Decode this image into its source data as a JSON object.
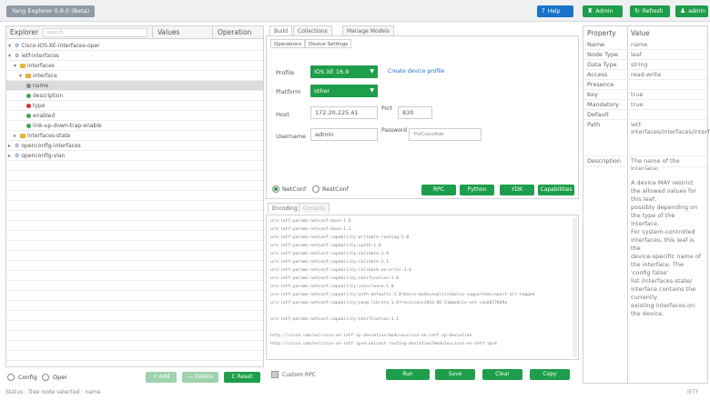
{
  "app": {
    "title": "Yang Explorer 0.8.0 (Beta)"
  },
  "top_buttons": {
    "help": "Help",
    "admin": "Admin",
    "refresh": "Refresh",
    "user": "admin"
  },
  "explorer": {
    "col_explorer": "Explorer",
    "search_placeholder": "search",
    "col_values": "Values",
    "col_operation": "Operation",
    "tree": [
      {
        "label": "Cisco-IOS-XE-interfaces-oper",
        "icon": "node"
      },
      {
        "label": "ietf-interfaces",
        "icon": "node"
      },
      {
        "label": "interfaces",
        "icon": "folder"
      },
      {
        "label": "interface",
        "icon": "folder"
      },
      {
        "label": "name",
        "icon": "key"
      },
      {
        "label": "description",
        "icon": "leaf"
      },
      {
        "label": "type",
        "icon": "leaf-red"
      },
      {
        "label": "enabled",
        "icon": "leaf"
      },
      {
        "label": "link-up-down-trap-enable",
        "icon": "leaf"
      },
      {
        "label": "interfaces-state",
        "icon": "folder"
      },
      {
        "label": "openconfig-interfaces",
        "icon": "node"
      },
      {
        "label": "openconfig-vlan",
        "icon": "node"
      }
    ],
    "footer": {
      "config": "Config",
      "oper": "Oper",
      "add": "+ Add",
      "delete": "— Delete",
      "reset": "C Reset"
    }
  },
  "center": {
    "tabs": [
      "Build",
      "Collections",
      "Manage Models"
    ],
    "subtabs": [
      "Operations",
      "Device Settings"
    ],
    "profile": {
      "label": "Profile",
      "value": "IOS XE 16.9"
    },
    "create_profile": "Create device profile",
    "platform": {
      "label": "Platform",
      "value": "other"
    },
    "host": {
      "label": "Host",
      "value": "172.20.225.41"
    },
    "port": {
      "label": "Port",
      "value": "830"
    },
    "username": {
      "label": "Username",
      "value": "admin"
    },
    "password": {
      "label": "Password",
      "value": "YtzCisco4de"
    },
    "protocols": {
      "netconf": "NetConf",
      "restconf": "RestConf"
    },
    "action_buttons": [
      "RPC",
      "Python",
      "YDK",
      "Capabilities"
    ],
    "code_tabs": [
      "Encoding",
      "Console"
    ],
    "code_lines": [
      "urn:ietf:params:netconf:base:1.0",
      "urn:ietf:params:netconf:base:1.1",
      "urn:ietf:params:netconf:capability:writable-running:1.0",
      "urn:ietf:params:netconf:capability:xpath:1.0",
      "urn:ietf:params:netconf:capability:validate:1.0",
      "urn:ietf:params:netconf:capability:validate:1.1",
      "urn:ietf:params:netconf:capability:rollback-on-error:1.0",
      "urn:ietf:params:netconf:capability:notification:1.0",
      "urn:ietf:params:netconf:capability:interleave:1.0",
      "urn:ietf:params:netconf:capability:with-defaults:1.0?basic-mode=explicit&also-supported=report-all-tagged",
      "urn:ietf:params:netconf:capability:yang-library:1.0?revision=2016-06-21&module-set-id=86278d9a",
      "",
      "urn:ietf:params:netconf:capability:notification:1.1",
      "",
      "http://cisco.com/ns/cisco-xe-ietf-ip-deviation?module=cisco-xe-ietf-ip-deviation",
      "http://cisco.com/ns/cisco-xe-ietf-ipv4-unicast-routing-deviation?module=cisco-xe-ietf-ipv4"
    ],
    "custom_rpc": "Custom RPC",
    "run_buttons": [
      "Run",
      "Save",
      "Clear",
      "Copy"
    ]
  },
  "props": {
    "col_property": "Property",
    "col_value": "Value",
    "rows": [
      {
        "name": "Name",
        "value": "name"
      },
      {
        "name": "Node Type",
        "value": "leaf"
      },
      {
        "name": "Data Type",
        "value": "string"
      },
      {
        "name": "Access",
        "value": "read-write"
      },
      {
        "name": "Presence",
        "value": ""
      },
      {
        "name": "Key",
        "value": "true"
      },
      {
        "name": "Mandatory",
        "value": "true"
      },
      {
        "name": "Default",
        "value": ""
      },
      {
        "name": "Path",
        "value": "ietf-interfaces/interfaces/interface/name"
      },
      {
        "name": "Description",
        "value": "The name of the interface."
      }
    ],
    "description_long": [
      "A device MAY restrict",
      "the allowed values for",
      "this leaf,",
      "possibly depending on",
      "the type of the",
      "interface.",
      "For system-controlled",
      "interfaces, this leaf is",
      "the",
      "device-specific name of",
      "the interface. The",
      "'config false'",
      "list /interfaces-state/",
      "interface contains the",
      "currently",
      "existing interfaces on",
      "the device."
    ]
  },
  "status": {
    "text": "Status : Tree node selected : name",
    "right": "IETF"
  }
}
